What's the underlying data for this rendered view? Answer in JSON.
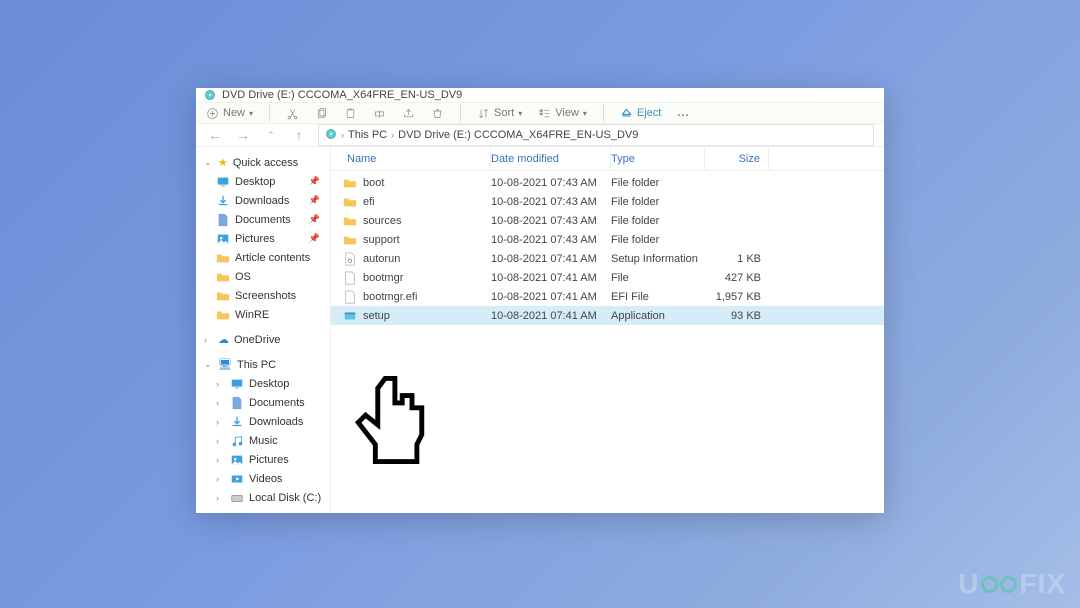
{
  "window": {
    "title": "DVD Drive (E:) CCCOMA_X64FRE_EN-US_DV9"
  },
  "toolbar": {
    "new": "New",
    "sort": "Sort",
    "view": "View",
    "eject": "Eject",
    "more": "..."
  },
  "breadcrumb": {
    "root": "This PC",
    "leaf": "DVD Drive (E:) CCCOMA_X64FRE_EN-US_DV9"
  },
  "sidebar": {
    "quick": "Quick access",
    "items_quick": [
      {
        "label": "Desktop",
        "pin": true,
        "icon": "desktop"
      },
      {
        "label": "Downloads",
        "pin": true,
        "icon": "downloads"
      },
      {
        "label": "Documents",
        "pin": true,
        "icon": "documents"
      },
      {
        "label": "Pictures",
        "pin": true,
        "icon": "pictures"
      },
      {
        "label": "Article contents",
        "pin": false,
        "icon": "folder"
      },
      {
        "label": "OS",
        "pin": false,
        "icon": "folder"
      },
      {
        "label": "Screenshots",
        "pin": false,
        "icon": "folder"
      },
      {
        "label": "WinRE",
        "pin": false,
        "icon": "folder"
      }
    ],
    "onedrive": "OneDrive",
    "thispc": "This PC",
    "items_pc": [
      {
        "label": "Desktop",
        "icon": "desktop"
      },
      {
        "label": "Documents",
        "icon": "documents"
      },
      {
        "label": "Downloads",
        "icon": "downloads"
      },
      {
        "label": "Music",
        "icon": "music"
      },
      {
        "label": "Pictures",
        "icon": "pictures"
      },
      {
        "label": "Videos",
        "icon": "videos"
      },
      {
        "label": "Local Disk (C:)",
        "icon": "disk"
      }
    ]
  },
  "columns": {
    "name": "Name",
    "date": "Date modified",
    "type": "Type",
    "size": "Size"
  },
  "rows": [
    {
      "name": "boot",
      "date": "10-08-2021 07:43 AM",
      "type": "File folder",
      "size": "",
      "icon": "folder",
      "selected": false
    },
    {
      "name": "efi",
      "date": "10-08-2021 07:43 AM",
      "type": "File folder",
      "size": "",
      "icon": "folder",
      "selected": false
    },
    {
      "name": "sources",
      "date": "10-08-2021 07:43 AM",
      "type": "File folder",
      "size": "",
      "icon": "folder",
      "selected": false
    },
    {
      "name": "support",
      "date": "10-08-2021 07:43 AM",
      "type": "File folder",
      "size": "",
      "icon": "folder",
      "selected": false
    },
    {
      "name": "autorun",
      "date": "10-08-2021 07:41 AM",
      "type": "Setup Information",
      "size": "1 KB",
      "icon": "config",
      "selected": false
    },
    {
      "name": "bootmgr",
      "date": "10-08-2021 07:41 AM",
      "type": "File",
      "size": "427 KB",
      "icon": "file",
      "selected": false
    },
    {
      "name": "bootmgr.efi",
      "date": "10-08-2021 07:41 AM",
      "type": "EFI File",
      "size": "1,957 KB",
      "icon": "file",
      "selected": false
    },
    {
      "name": "setup",
      "date": "10-08-2021 07:41 AM",
      "type": "Application",
      "size": "93 KB",
      "icon": "app",
      "selected": true
    }
  ],
  "watermark": {
    "pre": "U",
    "mid": "FIX"
  }
}
